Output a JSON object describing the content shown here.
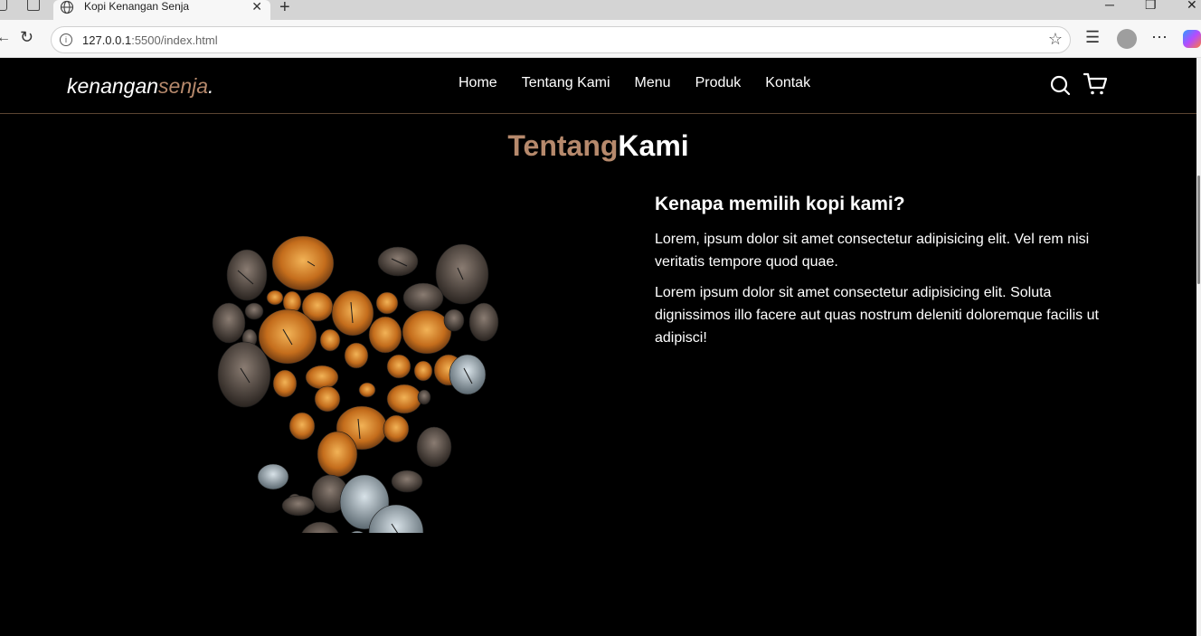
{
  "browser": {
    "tab_title": "Kopi Kenangan Senja",
    "url_host": "127.0.0.1",
    "url_rest": ":5500/index.html"
  },
  "navbar": {
    "logo_main": "kenangan",
    "logo_accent": "senja",
    "logo_dot": ".",
    "links": [
      "Home",
      "Tentang Kami",
      "Menu",
      "Produk",
      "Kontak"
    ]
  },
  "about": {
    "title_accent": "Tentang",
    "title_main": "Kami",
    "heading": "Kenapa memilih kopi kami?",
    "paragraph_1": "Lorem, ipsum dolor sit amet consectetur adipisicing elit. Vel rem nisi veritatis tempore quod quae.",
    "paragraph_2": "Lorem ipsum dolor sit amet consectetur adipisicing elit. Soluta dignissimos illo facere aut quas nostrum deleniti doloremque facilis ut adipisci!"
  },
  "colors": {
    "accent": "#b6896c",
    "background": "#000000",
    "text": "#ffffff"
  },
  "icons": [
    "search-icon",
    "cart-icon",
    "globe-icon",
    "reload-icon",
    "star-icon",
    "info-icon"
  ]
}
